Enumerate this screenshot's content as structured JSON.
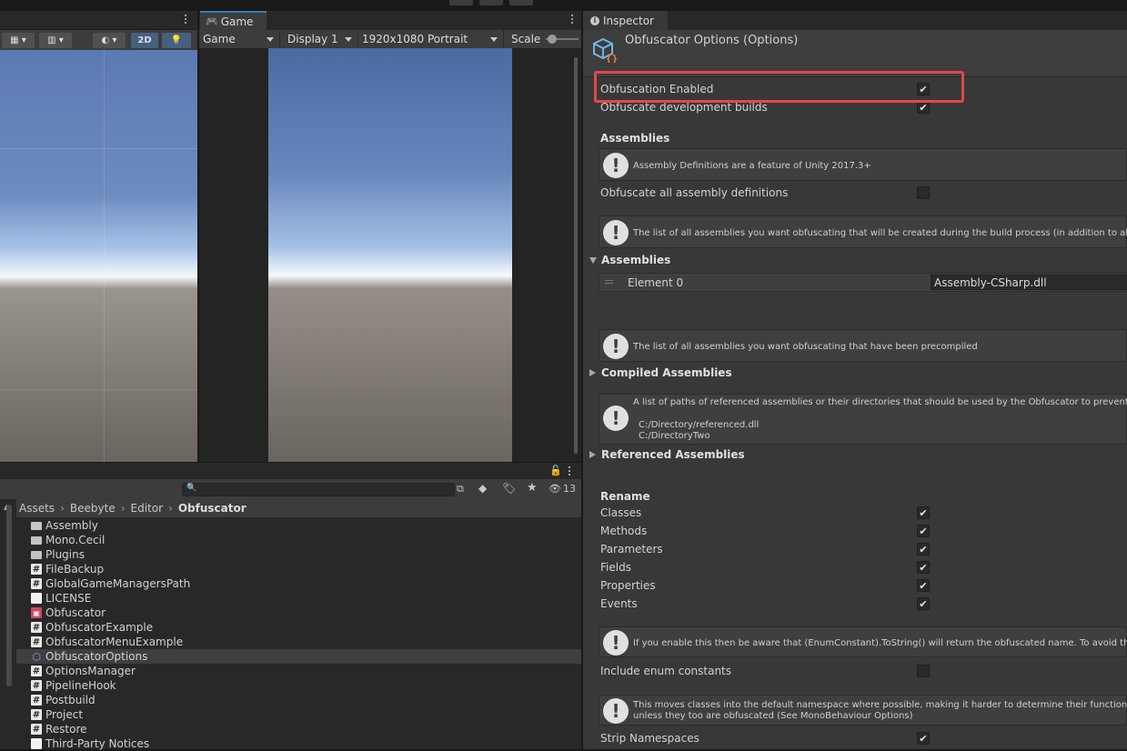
{
  "colors": {
    "accent": "#3a79bb",
    "highlight": "#e0474c",
    "panel": "#383838",
    "toolbar": "#3c3c3c"
  },
  "scene": {
    "toolbar": {
      "btn_2d": "2D"
    }
  },
  "game": {
    "tab_label": "Game",
    "toolbar": {
      "mode": "Game",
      "display": "Display 1",
      "resolution": "1920x1080 Portrait",
      "scale_label": "Scale"
    }
  },
  "project": {
    "toolbar": {
      "visible_count": "13"
    },
    "breadcrumb": [
      "Assets",
      "Beebyte",
      "Editor",
      "Obfuscator"
    ],
    "items": [
      {
        "name": "Assembly",
        "type": "folder-icon"
      },
      {
        "name": "Mono.Cecil",
        "type": "folder-icon"
      },
      {
        "name": "Plugins",
        "type": "folder-icon"
      },
      {
        "name": "FileBackup",
        "type": "script-icon"
      },
      {
        "name": "GlobalGameManagersPath",
        "type": "script-icon"
      },
      {
        "name": "LICENSE",
        "type": "file-icon"
      },
      {
        "name": "Obfuscator",
        "type": "config-icon"
      },
      {
        "name": "ObfuscatorExample",
        "type": "script-icon"
      },
      {
        "name": "ObfuscatorMenuExample",
        "type": "script-icon"
      },
      {
        "name": "ObfuscatorOptions",
        "type": "scriptable-object-icon",
        "selected": true
      },
      {
        "name": "OptionsManager",
        "type": "script-icon"
      },
      {
        "name": "PipelineHook",
        "type": "script-icon"
      },
      {
        "name": "Postbuild",
        "type": "script-icon"
      },
      {
        "name": "Project",
        "type": "script-icon"
      },
      {
        "name": "Restore",
        "type": "script-icon"
      },
      {
        "name": "Third-Party Notices",
        "type": "file-icon"
      }
    ]
  },
  "inspector": {
    "tab_label": "Inspector",
    "title": "Obfuscator Options (Options)",
    "obfuscation_enabled": {
      "label": "Obfuscation Enabled",
      "checked": true
    },
    "obfuscate_dev": {
      "label": "Obfuscate development builds",
      "checked": true
    },
    "assemblies_header": "Assemblies",
    "help_asmdef": "Assembly Definitions are a feature of Unity 2017.3+",
    "obfuscate_all_asmdef": {
      "label": "Obfuscate all assembly definitions",
      "checked": false
    },
    "help_assemblies": "The list of all assemblies you want obfuscating that will be created during the build process (in addition to all asse",
    "assemblies_list": {
      "label": "Assemblies",
      "element_label": "Element 0",
      "element_value": "Assembly-CSharp.dll"
    },
    "help_compiled": "The list of all assemblies you want obfuscating that have been precompiled",
    "compiled_label": "Compiled Assemblies",
    "help_referenced_1": "A list of paths of referenced assemblies or their directories that should be used by the Obfuscator to prevent As",
    "help_referenced_2": "C:/Directory/referenced.dll",
    "help_referenced_3": "C:/DirectoryTwo",
    "referenced_label": "Referenced Assemblies",
    "rename_header": "Rename",
    "rename_options": [
      {
        "label": "Classes",
        "checked": true
      },
      {
        "label": "Methods",
        "checked": true
      },
      {
        "label": "Parameters",
        "checked": true
      },
      {
        "label": "Fields",
        "checked": true
      },
      {
        "label": "Properties",
        "checked": true
      },
      {
        "label": "Events",
        "checked": true
      }
    ],
    "help_enum": "If you enable this then be aware that (EnumConstant).ToString() will return the obfuscated name. To avoid this,",
    "include_enum": {
      "label": "Include enum constants",
      "checked": false
    },
    "help_namespace_1": "This moves classes into the default namespace where possible, making it harder to determine their function. Not",
    "help_namespace_2": "unless they too are obfuscated (See MonoBehaviour Options)",
    "strip_namespaces": {
      "label": "Strip Namespaces",
      "checked": true
    }
  }
}
